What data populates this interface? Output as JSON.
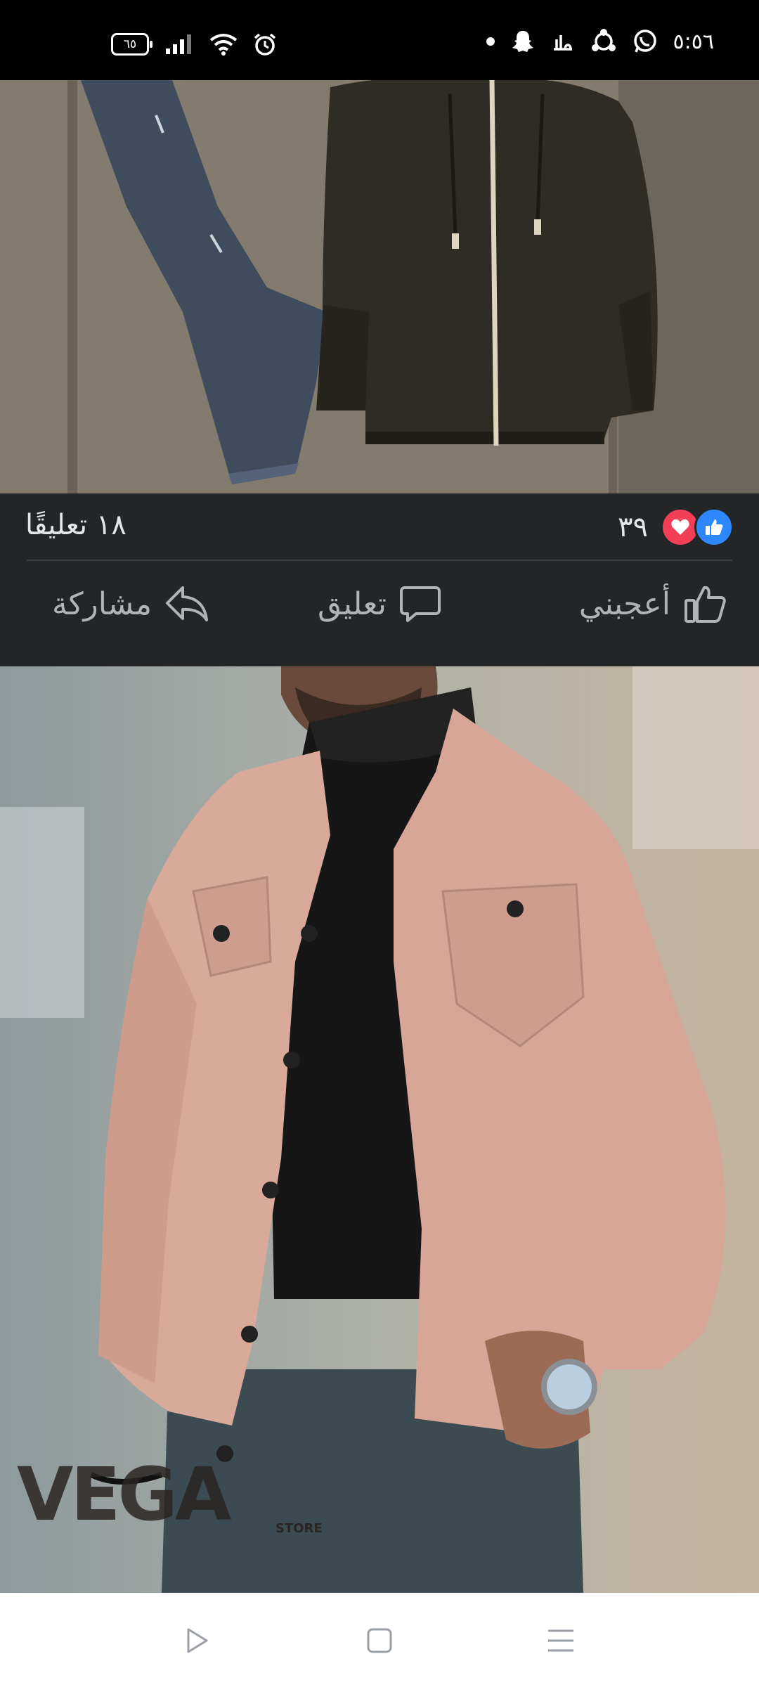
{
  "status_bar": {
    "time": "٥:٥٦",
    "battery": "٦٥",
    "left_icons": [
      "battery-icon",
      "signal-icon",
      "wifi-icon",
      "alarm-icon"
    ],
    "right_icons": [
      "notification-dot",
      "snapchat-icon",
      "talabat-icon",
      "share-app-icon",
      "whatsapp-icon"
    ]
  },
  "post": {
    "comments_count": "١٨ تعليقًا",
    "reactions_count": "٣٩",
    "reactions": [
      "like-icon",
      "love-icon"
    ],
    "actions": {
      "like": "أعجبني",
      "comment": "تعليق",
      "share": "مشاركة"
    }
  },
  "images": {
    "top": "jeans-and-olive-jacket-photo",
    "bottom": "pink-denim-jacket-model-photo",
    "watermark_brand": "VEGA",
    "watermark_sub": "STORE"
  },
  "nav_bar": {
    "buttons": [
      "back-icon",
      "home-icon",
      "menu-icon"
    ]
  },
  "colors": {
    "card_bg": "#242526",
    "text": "#e4e6eb",
    "secondary": "#b0b3b8",
    "like_blue": "#2d88ff",
    "love_red": "#f33e58"
  }
}
